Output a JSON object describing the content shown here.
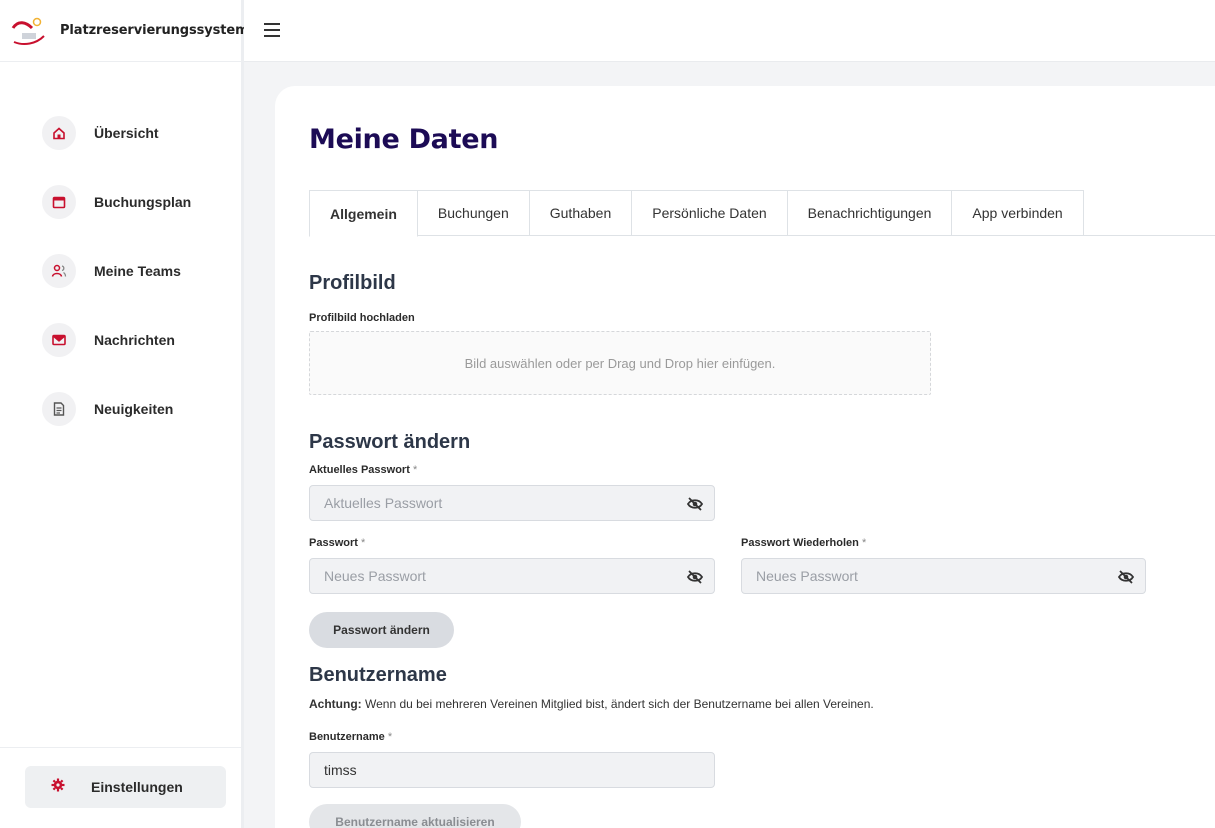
{
  "app": {
    "title": "Platzreservierungssystem"
  },
  "sidebar": {
    "items": [
      {
        "label": "Übersicht",
        "icon": "home-icon"
      },
      {
        "label": "Buchungsplan",
        "icon": "calendar-icon"
      },
      {
        "label": "Meine Teams",
        "icon": "users-icon"
      },
      {
        "label": "Nachrichten",
        "icon": "mail-icon"
      },
      {
        "label": "Neuigkeiten",
        "icon": "document-icon"
      }
    ],
    "settings": {
      "label": "Einstellungen",
      "icon": "gear-icon"
    }
  },
  "page": {
    "title": "Meine Daten",
    "tabs": [
      {
        "label": "Allgemein",
        "active": true
      },
      {
        "label": "Buchungen"
      },
      {
        "label": "Guthaben"
      },
      {
        "label": "Persönliche Daten"
      },
      {
        "label": "Benachrichtigungen"
      },
      {
        "label": "App verbinden"
      }
    ]
  },
  "profile": {
    "section_title": "Profilbild",
    "upload_label": "Profilbild hochladen",
    "dropzone_text": "Bild auswählen oder per Drag und Drop hier einfügen."
  },
  "password": {
    "section_title": "Passwort ändern",
    "current_label": "Aktuelles Passwort",
    "current_placeholder": "Aktuelles Passwort",
    "new_label": "Passwort",
    "new_placeholder": "Neues Passwort",
    "repeat_label": "Passwort Wiederholen",
    "repeat_placeholder": "Neues Passwort",
    "required_mark": "*",
    "submit_label": "Passwort ändern"
  },
  "username": {
    "section_title": "Benutzername",
    "warning_strong": "Achtung:",
    "warning_text": " Wenn du bei mehreren Vereinen Mitglied bist, ändert sich der Benutzername bei allen Vereinen.",
    "label": "Benutzername",
    "value": "timss",
    "submit_label": "Benutzername aktualisieren"
  },
  "colors": {
    "brand_red": "#c8102e",
    "title_navy": "#1c0b55"
  }
}
